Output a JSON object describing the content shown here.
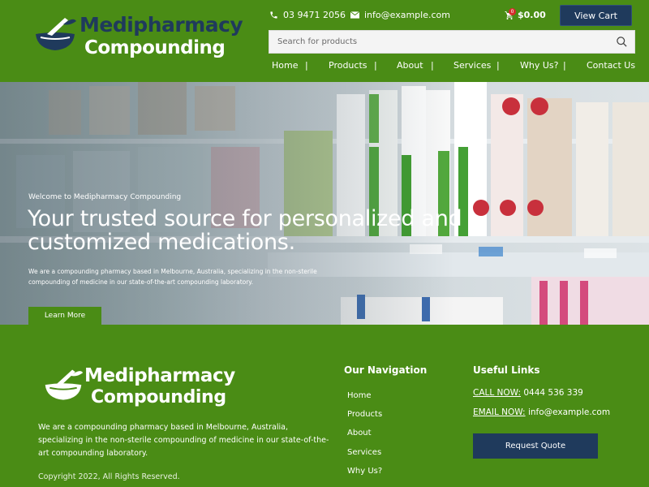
{
  "brand": {
    "name_line1": "Medipharmacy",
    "name_line2": "Compounding",
    "primary_color": "#4a8c15",
    "navy_color": "#1f3a5c"
  },
  "header": {
    "phone": "03 9471 2056",
    "email": "info@example.com",
    "cart_count": "0",
    "cart_total": "$0.00",
    "view_cart_label": "View Cart",
    "search_placeholder": "Search for products",
    "nav": [
      {
        "label": "Home"
      },
      {
        "label": "Products"
      },
      {
        "label": "About"
      },
      {
        "label": "Services"
      },
      {
        "label": "Why Us?"
      },
      {
        "label": "Contact Us"
      }
    ]
  },
  "hero": {
    "welcome": "Welcome to Medipharmacy Compounding",
    "title": "Your trusted source for personalized and customized medications.",
    "description": "We are a compounding pharmacy based in Melbourne, Australia, specializing in the non-sterile compounding of medicine in our state-of-the-art compounding laboratory.",
    "cta_label": "Learn More"
  },
  "footer": {
    "description": "We are a compounding pharmacy based in Melbourne, Australia, specializing in the non-sterile compounding of medicine in our state-of-the-art compounding laboratory.",
    "copyright": "Copyright 2022, All Rights Reserved.",
    "nav_heading": "Our Navigation",
    "nav_items": [
      {
        "label": "Home"
      },
      {
        "label": "Products"
      },
      {
        "label": "About"
      },
      {
        "label": "Services"
      },
      {
        "label": "Why Us?"
      }
    ],
    "links_heading": "Useful Links",
    "call_label": "CALL NOW:",
    "call_value": "0444 536 339",
    "email_label": "EMAIL NOW:",
    "email_value": "info@example.com",
    "quote_label": "Request Quote"
  }
}
